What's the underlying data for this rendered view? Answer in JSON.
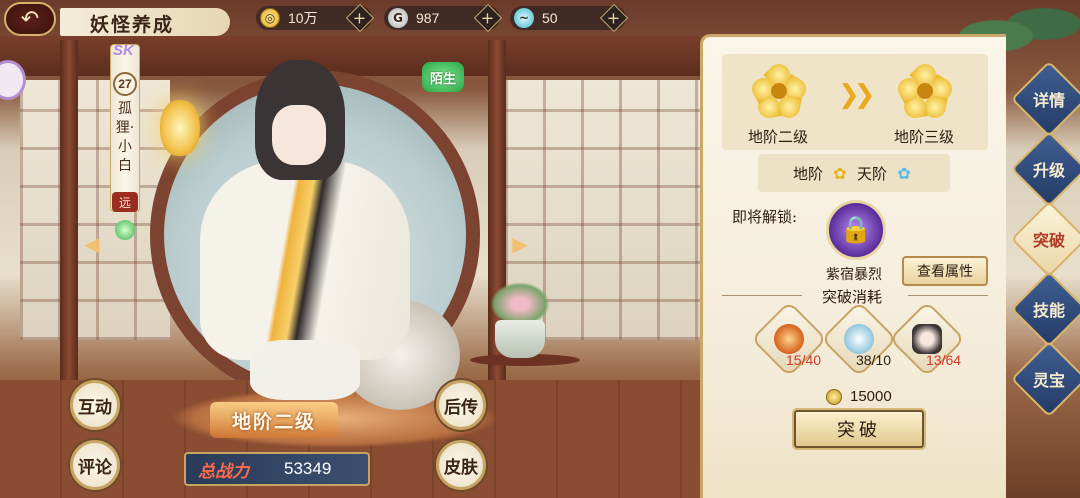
{
  "header": {
    "title": "妖怪养成",
    "currencies": [
      {
        "icon": "gold-coin-icon",
        "value": "10万",
        "color": "#e8b21c"
      },
      {
        "icon": "silver-coin-icon",
        "value": "987",
        "color": "#c9c9c9"
      },
      {
        "icon": "jade-swirl-icon",
        "value": "50",
        "color": "#5ac7d8"
      }
    ],
    "plus": "+"
  },
  "character": {
    "rarity": "SK",
    "level": "27",
    "name": "孤狸·小白",
    "range": "远",
    "relation_badge": "陌生",
    "stage_label": "地阶二级",
    "power_label": "总战力",
    "power_value": "53349"
  },
  "left_actions": {
    "interact": "互动",
    "comment": "评论",
    "backstory": "后传",
    "skin": "皮肤"
  },
  "panel": {
    "current_rank": "地阶二级",
    "next_rank": "地阶三级",
    "tier_from": "地阶",
    "tier_to": "天阶",
    "unlock_label": "即将解锁:",
    "skill_name": "紫宿暴烈",
    "view_attr_button": "查看属性",
    "cost_title": "突破消耗",
    "materials": [
      {
        "icon": "amber-orb-icon",
        "count": "15/40",
        "count_color": "#d6382a"
      },
      {
        "icon": "crystal-orb-icon",
        "count": "38/10",
        "count_color": "#2c1c10"
      },
      {
        "icon": "fox-portrait-icon",
        "count": "13/64",
        "count_color": "#d6382a"
      }
    ],
    "gold_cost": "15000",
    "break_button": "突破"
  },
  "side_nav": [
    {
      "label": "详情",
      "active": false
    },
    {
      "label": "升级",
      "active": false
    },
    {
      "label": "突破",
      "active": true
    },
    {
      "label": "技能",
      "active": false
    },
    {
      "label": "灵宝",
      "active": false
    }
  ]
}
